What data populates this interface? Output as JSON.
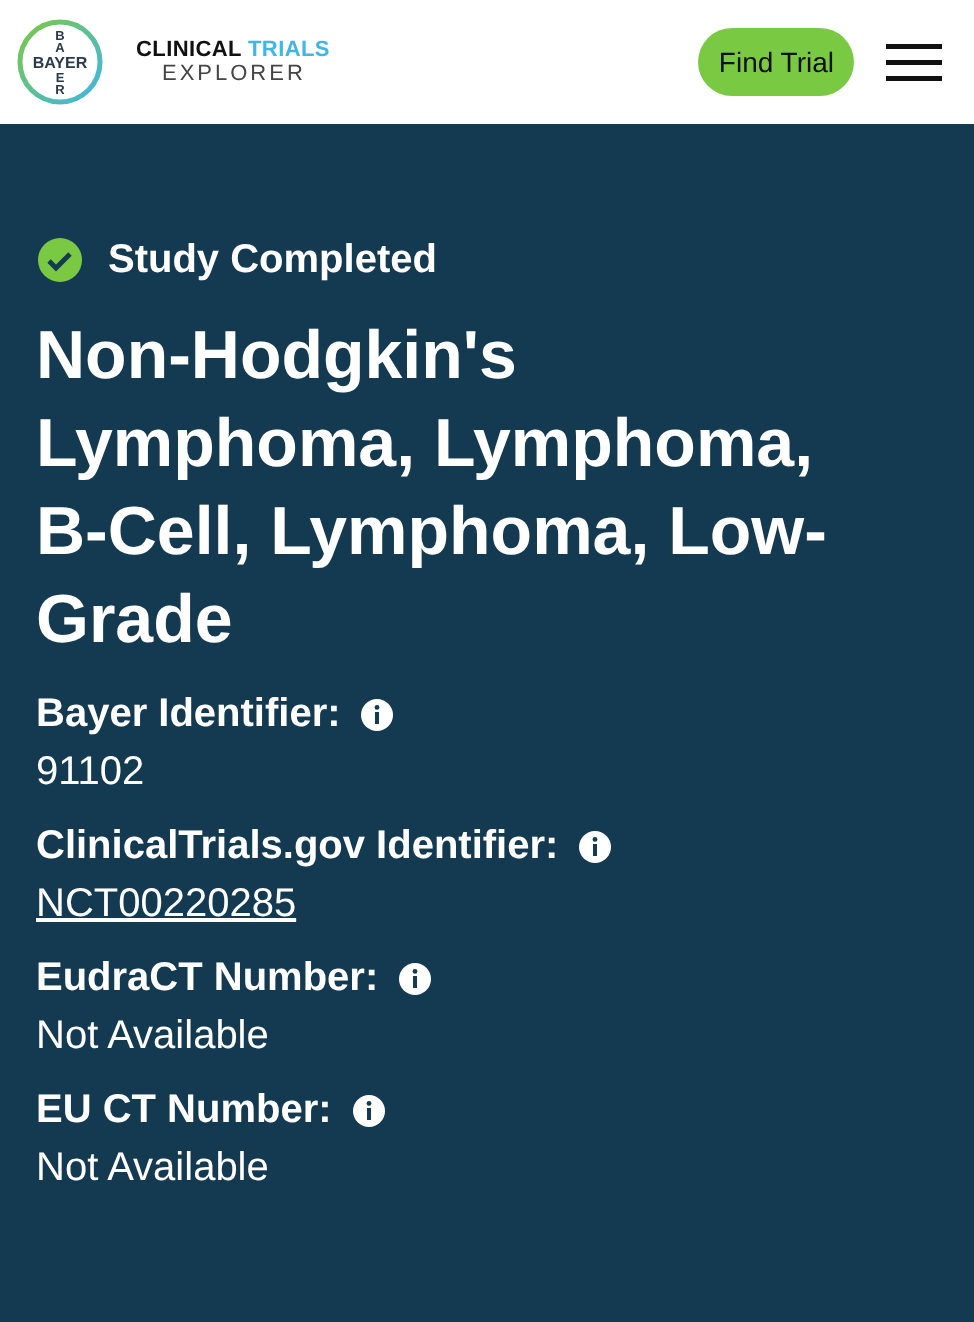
{
  "header": {
    "logo": {
      "horizontal": "BAYER",
      "top": "BA",
      "bottom": "ER"
    },
    "brand_line1": "CLINICAL",
    "brand_line1_accent": "TRIALS",
    "brand_line2": "EXPLORER",
    "button": "Find Trial"
  },
  "status": {
    "label": "Study Completed",
    "completed": true
  },
  "title": "Non-Hodgkin's Lymphoma, Lymphoma, B-Cell, Lymphoma, Low-Grade",
  "fields": [
    {
      "label": "Bayer Identifier:",
      "value": "91102",
      "link": false
    },
    {
      "label": "ClinicalTrials.gov Identifier:",
      "value": "NCT00220285",
      "link": true
    },
    {
      "label": "EudraCT Number:",
      "value": "Not Available",
      "link": false
    },
    {
      "label": "EU CT Number:",
      "value": "Not Available",
      "link": false
    }
  ]
}
